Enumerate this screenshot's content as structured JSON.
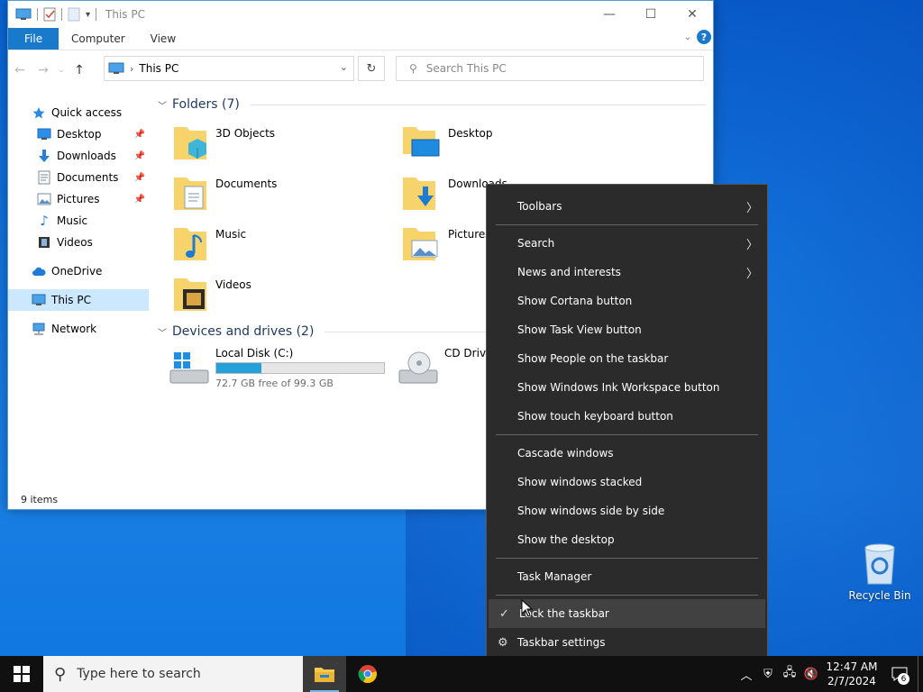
{
  "window": {
    "title": "This PC",
    "ribbon_tabs": [
      "File",
      "Computer",
      "View"
    ],
    "address_path": "This PC",
    "search_placeholder": "Search This PC",
    "status": "9 items"
  },
  "nav": {
    "items": [
      {
        "label": "Quick access",
        "icon": "star-icon"
      },
      {
        "label": "Desktop",
        "icon": "desktop-icon",
        "pinned": true
      },
      {
        "label": "Downloads",
        "icon": "download-arrow-icon",
        "pinned": true
      },
      {
        "label": "Documents",
        "icon": "documents-icon",
        "pinned": true
      },
      {
        "label": "Pictures",
        "icon": "pictures-icon",
        "pinned": true
      },
      {
        "label": "Music",
        "icon": "music-note-icon"
      },
      {
        "label": "Videos",
        "icon": "film-icon"
      },
      {
        "label": "OneDrive",
        "icon": "cloud-icon"
      },
      {
        "label": "This PC",
        "icon": "computer-icon",
        "selected": true
      },
      {
        "label": "Network",
        "icon": "network-icon"
      }
    ]
  },
  "folders": {
    "header": "Folders (7)",
    "items": [
      "3D Objects",
      "Desktop",
      "Documents",
      "Downloads",
      "Music",
      "Pictures",
      "Videos"
    ]
  },
  "drives": {
    "header": "Devices and drives (2)",
    "items": [
      {
        "label": "Local Disk (C:)",
        "free": "72.7 GB free of 99.3 GB",
        "used_fraction": 0.27
      },
      {
        "label": "CD Drive"
      }
    ]
  },
  "context_menu": {
    "toolbars": "Toolbars",
    "search": "Search",
    "news": "News and interests",
    "cortana": "Show Cortana button",
    "taskview": "Show Task View button",
    "people": "Show People on the taskbar",
    "ink": "Show Windows Ink Workspace button",
    "touch": "Show touch keyboard button",
    "cascade": "Cascade windows",
    "stacked": "Show windows stacked",
    "sidebyside": "Show windows side by side",
    "showdesktop": "Show the desktop",
    "taskmgr": "Task Manager",
    "lock": "Lock the taskbar",
    "settings": "Taskbar settings"
  },
  "desktop": {
    "recycle_bin": "Recycle Bin"
  },
  "taskbar": {
    "search_placeholder": "Type here to search",
    "time": "12:47 AM",
    "date": "2/7/2024",
    "notifications": "6"
  },
  "colors": {
    "accent": "#1979ca",
    "menu_bg": "#2b2b2b",
    "taskbar_bg": "#101010"
  }
}
